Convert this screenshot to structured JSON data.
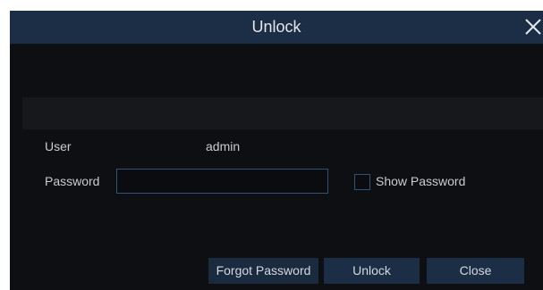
{
  "dialog": {
    "title": "Unlock",
    "close_icon": "close-icon"
  },
  "form": {
    "user_label": "User",
    "user_value": "admin",
    "password_label": "Password",
    "password_value": "",
    "password_placeholder": "",
    "show_password_label": "Show Password",
    "show_password_checked": false
  },
  "buttons": {
    "forgot_password": "Forgot Password",
    "unlock": "Unlock",
    "close": "Close"
  },
  "colors": {
    "titlebar": "#1c2e45",
    "background": "#0e0f12",
    "button": "#1c2e45",
    "input_border": "#2f5277"
  }
}
